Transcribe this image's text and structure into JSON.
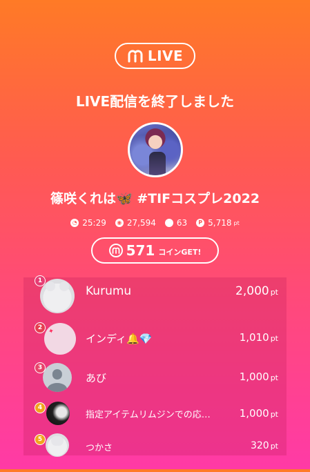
{
  "header": {
    "logo_text": "LIVE",
    "end_message": "LIVE配信を終了しました"
  },
  "stream": {
    "title": "篠咲くれは🦋 #TIFコスプレ2022"
  },
  "stats": {
    "duration": "25:29",
    "viewers": "27,594",
    "comments": "63",
    "points": "5,718",
    "points_unit": "pt"
  },
  "coins": {
    "amount": "571",
    "label": "コインGET!"
  },
  "ranking": [
    {
      "rank": "1",
      "name": "Kurumu",
      "points": "2,000",
      "unit": "pt",
      "badge_color": "#e63d73"
    },
    {
      "rank": "2",
      "name": "インディ🔔💎",
      "points": "1,010",
      "unit": "pt",
      "badge_color": "#e63d50"
    },
    {
      "rank": "3",
      "name": "あび",
      "points": "1,000",
      "unit": "pt",
      "badge_color": "#e8436a"
    },
    {
      "rank": "4",
      "name": "指定アイテムリムジンでの応…",
      "points": "1,000",
      "unit": "pt",
      "badge_color": "#f2a41d"
    },
    {
      "rank": "5",
      "name": "つかさ",
      "points": "320",
      "unit": "pt",
      "badge_color": "#f2a41d"
    }
  ],
  "icons": {
    "brand": "mildom-m-icon",
    "duration": "clock-icon",
    "viewers": "viewer-icon",
    "comments": "comment-icon",
    "points": "point-icon",
    "coin": "coin-icon"
  }
}
